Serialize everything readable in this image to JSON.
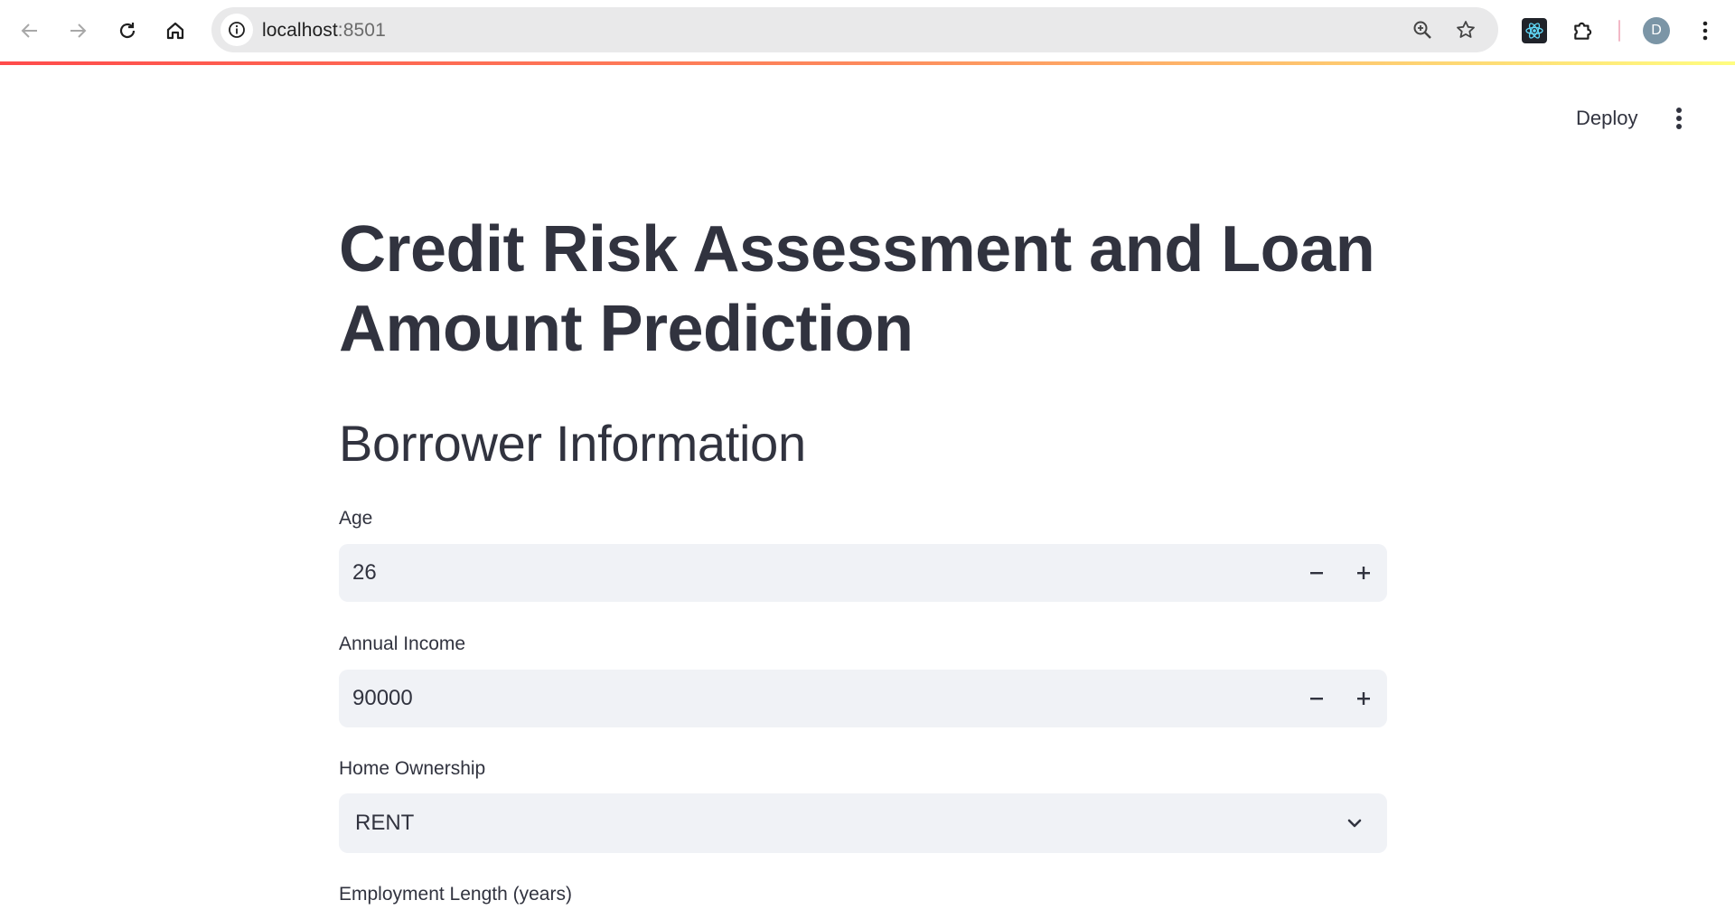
{
  "browser": {
    "url_host": "localhost",
    "url_port": ":8501",
    "profile_initial": "D",
    "icons": {
      "back": "arrow-left-icon",
      "forward": "arrow-right-icon",
      "reload": "reload-icon",
      "home": "home-icon",
      "site_info": "info-icon",
      "zoom": "zoom-icon",
      "bookmark": "star-icon",
      "react_devtools": "react-icon",
      "extensions": "puzzle-icon",
      "menu": "kebab-menu-icon"
    }
  },
  "header": {
    "deploy_label": "Deploy",
    "menu_icon": "kebab-menu-icon"
  },
  "page": {
    "title": "Credit Risk Assessment and Loan Amount Prediction",
    "section_title": "Borrower Information"
  },
  "form": {
    "age": {
      "label": "Age",
      "value": "26"
    },
    "annual_income": {
      "label": "Annual Income",
      "value": "90000"
    },
    "home_ownership": {
      "label": "Home Ownership",
      "value": "RENT"
    },
    "employment_length": {
      "label": "Employment Length (years)"
    }
  },
  "colors": {
    "text": "#31333f",
    "input_bg": "#f0f2f6",
    "accent_start": "#ff4b4b",
    "accent_end": "#fffd80"
  }
}
